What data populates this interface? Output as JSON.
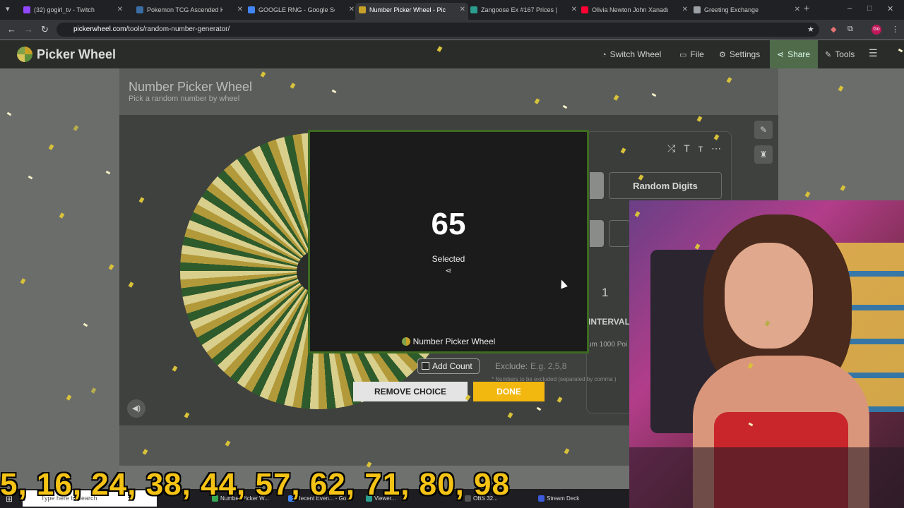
{
  "browser": {
    "tabs": [
      {
        "title": "(32) gogirl_tv - Twitch",
        "icon": "twitch-icon",
        "color": "#9146ff"
      },
      {
        "title": "Pokemon TCG Ascended Heroe",
        "icon": "tcg-icon",
        "color": "#3a6ea5"
      },
      {
        "title": "GOOGLE RNG - Google Search",
        "icon": "google-icon",
        "color": "#4285f4"
      },
      {
        "title": "Number Picker Wheel - Pick Ra",
        "icon": "picker-wheel-icon",
        "color": "#c8a128"
      },
      {
        "title": "Zangoose Ex #167 Prices | Pok",
        "icon": "pricecharting-icon",
        "color": "#2a9d8f"
      },
      {
        "title": "Olivia Newton John Xanadu Or",
        "icon": "youtube-icon",
        "color": "#ff0033"
      },
      {
        "title": "Greeting Exchange",
        "icon": "globe-icon",
        "color": "#9aa0a6"
      }
    ],
    "url_host": "pickerwheel.com",
    "url_path": "/tools/random-number-generator/"
  },
  "site": {
    "logo": "Picker Wheel",
    "nav": [
      "Switch Wheel",
      "File",
      "Settings",
      "Share",
      "Tools"
    ],
    "page_title": "Number Picker Wheel",
    "page_subtitle": "Pick a random number by wheel"
  },
  "panel": {
    "random_digits_label": "Random Digits",
    "interval_value": "1",
    "interval_label": "INTERVAL",
    "max_hint": "um 1000 Poi",
    "exclude_label": "Exclude:",
    "exclude_placeholder": "E.g. 2,5,8",
    "exclude_hint": "* Numbers to be excluded (separated by comma )"
  },
  "modal": {
    "result": "65",
    "result_label": "Selected",
    "brand": "Number Picker Wheel"
  },
  "actions": {
    "add_count": "Add Count",
    "remove_choice": "REMOVE CHOICE",
    "done": "DONE"
  },
  "overlay": {
    "picked_numbers": "5, 16, 24, 38, 44, 57, 62, 71, 80, 98"
  },
  "taskbar": {
    "search_placeholder": "Type here to search",
    "apps": [
      {
        "label": "Number Picker W...",
        "color": "#34a853"
      },
      {
        "label": "Recent Even... - Go...",
        "color": "#4285f4"
      },
      {
        "label": "Viewer...",
        "color": "#2a9d8f"
      },
      {
        "label": "OBS 32...",
        "color": "#555555"
      },
      {
        "label": "Stream Deck",
        "color": "#3b5bdb"
      }
    ]
  },
  "colors": {
    "accent_done": "#f3b80f",
    "modal_border": "#3d6b22",
    "overlay_numbers": "#f5c315"
  }
}
